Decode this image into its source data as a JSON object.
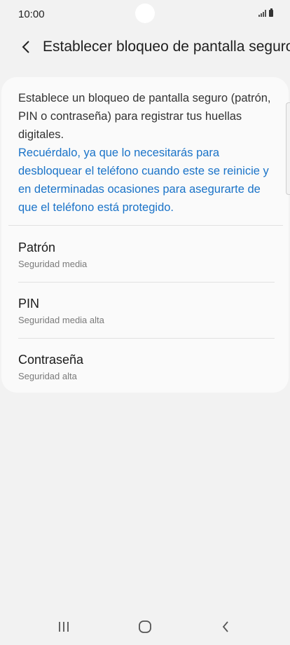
{
  "status_bar": {
    "time": "10:00"
  },
  "header": {
    "title": "Establecer bloqueo de pantalla seguro"
  },
  "content": {
    "description": "Establece un bloqueo de pantalla seguro (patrón, PIN o contraseña) para registrar tus huellas digitales.",
    "note": "Recuérdalo, ya que lo necesitarás para desbloquear el teléfono cuando este se reinicie y en determinadas ocasiones para asegurarte de que el teléfono está protegido."
  },
  "options": [
    {
      "title": "Patrón",
      "subtitle": "Seguridad media"
    },
    {
      "title": "PIN",
      "subtitle": "Seguridad media alta"
    },
    {
      "title": "Contraseña",
      "subtitle": "Seguridad alta"
    }
  ],
  "colors": {
    "accent": "#1a73c8",
    "background": "#f2f2f2",
    "card": "#fafafa"
  },
  "icons": [
    "back-arrow-icon",
    "signal-icon",
    "battery-icon",
    "recent-apps-icon",
    "home-icon",
    "nav-back-icon"
  ]
}
